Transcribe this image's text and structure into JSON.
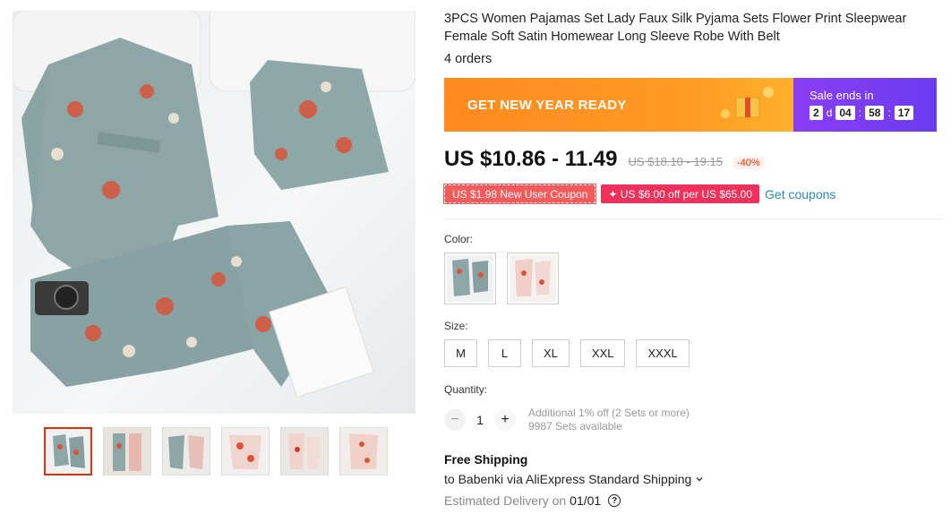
{
  "product": {
    "title": "3PCS Women Pajamas Set Lady Faux Silk Pyjama Sets Flower Print Sleepwear Female Soft Satin Homewear Long Sleeve Robe With Belt",
    "orders": "4 orders"
  },
  "gallery": {
    "thumbnail_count": 6,
    "selected_index": 0
  },
  "promo": {
    "banner_label": "GET NEW YEAR READY",
    "sale_label": "Sale ends in",
    "countdown": {
      "days": "2",
      "day_unit": "d",
      "hours": "04",
      "minutes": "58",
      "seconds": "17"
    },
    "colors": {
      "left": "#ff8a1f",
      "right": "#7b3ef3"
    }
  },
  "pricing": {
    "price": "US $10.86 - 11.49",
    "original_price": "US $18.10 - 19.15",
    "discount": "-40%"
  },
  "coupons": {
    "new_user": "US $1.98 New User Coupon",
    "store": "✦ US $6.00 off per US $65.00",
    "get_coupons": "Get coupons"
  },
  "options": {
    "color_label": "Color:",
    "colors": [
      "grey-blue floral",
      "pink floral"
    ],
    "selected_color": 0,
    "size_label": "Size:",
    "sizes": [
      "M",
      "L",
      "XL",
      "XXL",
      "XXXL"
    ]
  },
  "quantity": {
    "label": "Quantity:",
    "value": "1",
    "minus": "−",
    "plus": "+",
    "offer": "Additional 1% off (2 Sets or more)",
    "available": "9987 Sets available"
  },
  "shipping": {
    "title": "Free Shipping",
    "via": "to Babenki via AliExpress Standard Shipping",
    "est_label": "Estimated Delivery on",
    "est_date": "01/01"
  }
}
